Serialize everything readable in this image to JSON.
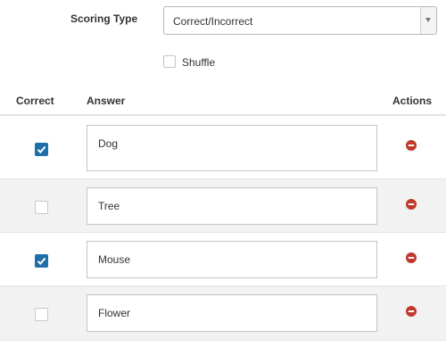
{
  "scoring": {
    "label": "Scoring Type",
    "selected": "Correct/Incorrect"
  },
  "shuffle": {
    "label": "Shuffle",
    "checked": false
  },
  "table": {
    "headers": {
      "correct": "Correct",
      "answer": "Answer",
      "actions": "Actions"
    },
    "rows": [
      {
        "correct": true,
        "answer": "Dog"
      },
      {
        "correct": false,
        "answer": "Tree"
      },
      {
        "correct": true,
        "answer": "Mouse"
      },
      {
        "correct": false,
        "answer": "Flower"
      }
    ]
  },
  "icons": {
    "remove": "minus-circle-icon",
    "check": "checkmark-icon",
    "dropdown": "triangle-down-icon"
  },
  "colors": {
    "checkbox_checked": "#1f6fa8",
    "remove_icon": "#c0392b",
    "row_shaded": "#f2f2f2"
  }
}
